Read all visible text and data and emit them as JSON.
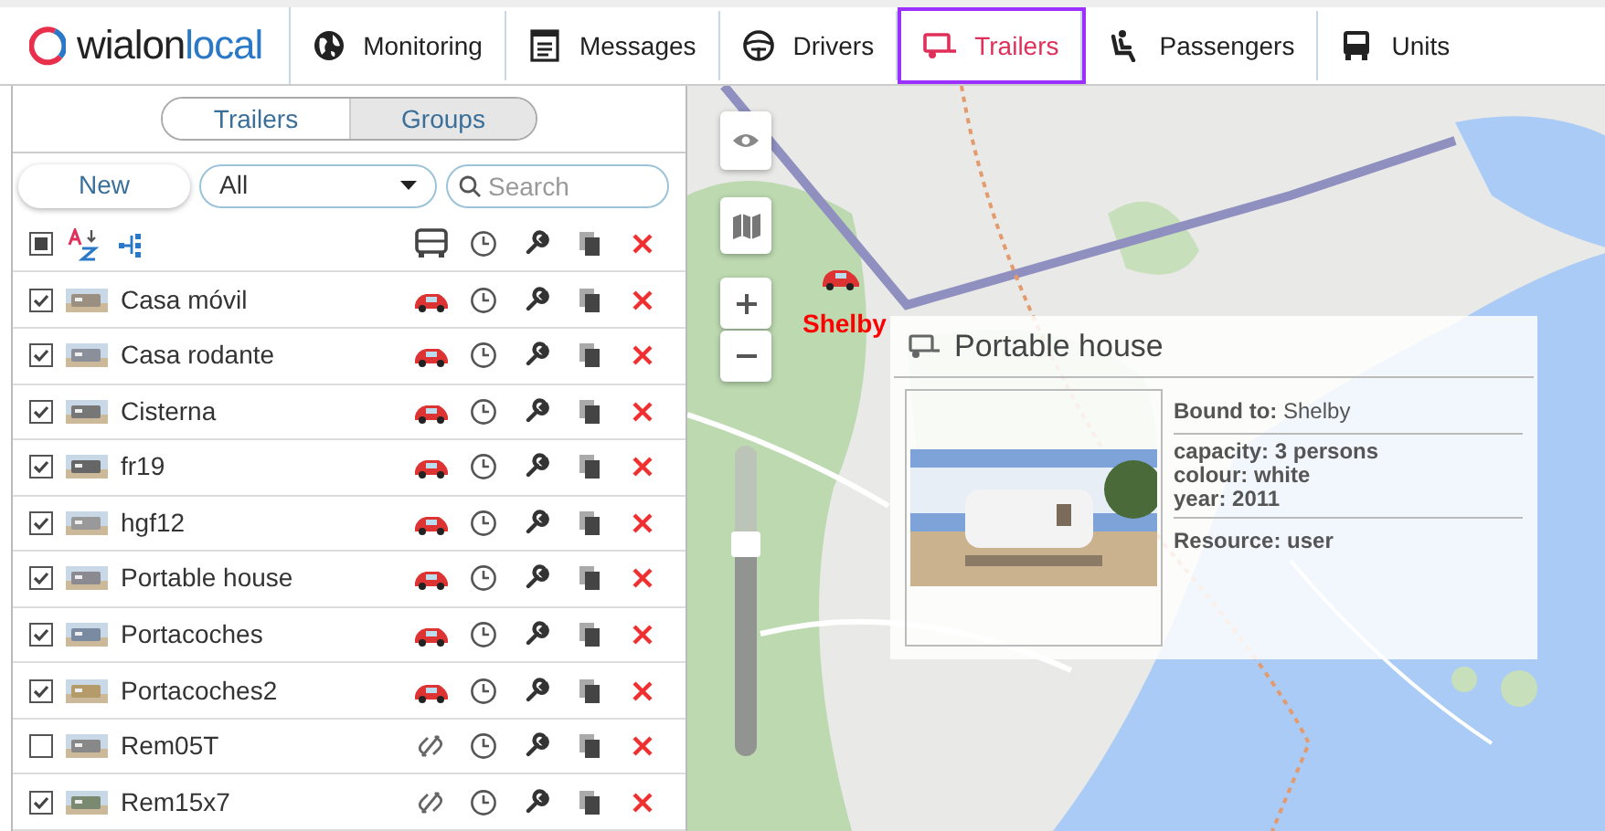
{
  "header": {
    "logo": {
      "brand": "wialon",
      "product": "local"
    },
    "nav": [
      {
        "label": "Monitoring",
        "kind": "globe",
        "selected": false
      },
      {
        "label": "Messages",
        "kind": "document",
        "selected": false
      },
      {
        "label": "Drivers",
        "kind": "wheel",
        "selected": false
      },
      {
        "label": "Trailers",
        "kind": "trailer",
        "selected": true
      },
      {
        "label": "Passengers",
        "kind": "seat",
        "selected": false
      },
      {
        "label": "Units",
        "kind": "bus",
        "selected": false
      }
    ]
  },
  "panel": {
    "tabs": [
      {
        "label": "Trailers",
        "selected": true
      },
      {
        "label": "Groups",
        "selected": false
      }
    ],
    "new_button": "New",
    "filter": {
      "value": "All"
    },
    "search": {
      "placeholder": "Search"
    },
    "select_all": {
      "indeterminate": true
    },
    "rows": [
      {
        "name": "Casa móvil",
        "checked": true,
        "bound": true
      },
      {
        "name": "Casa rodante",
        "checked": true,
        "bound": true
      },
      {
        "name": "Cisterna",
        "checked": true,
        "bound": true
      },
      {
        "name": "fr19",
        "checked": true,
        "bound": true
      },
      {
        "name": "hgf12",
        "checked": true,
        "bound": true
      },
      {
        "name": "Portable house",
        "checked": true,
        "bound": true
      },
      {
        "name": "Portacoches",
        "checked": true,
        "bound": true
      },
      {
        "name": "Portacoches2",
        "checked": true,
        "bound": true
      },
      {
        "name": "Rem05T",
        "checked": false,
        "bound": false
      },
      {
        "name": "Rem15x7",
        "checked": true,
        "bound": false
      }
    ]
  },
  "map": {
    "zoom_slider": {
      "level": 0.68
    },
    "unit_label": "Shelby",
    "popup": {
      "title": "Portable house",
      "bound_to": {
        "label": "Bound to:",
        "value": "Shelby"
      },
      "fields": [
        "capacity: 3 persons",
        "colour: white",
        "year: 2011"
      ],
      "resource": {
        "label": "Resource:",
        "value": "user"
      }
    }
  }
}
